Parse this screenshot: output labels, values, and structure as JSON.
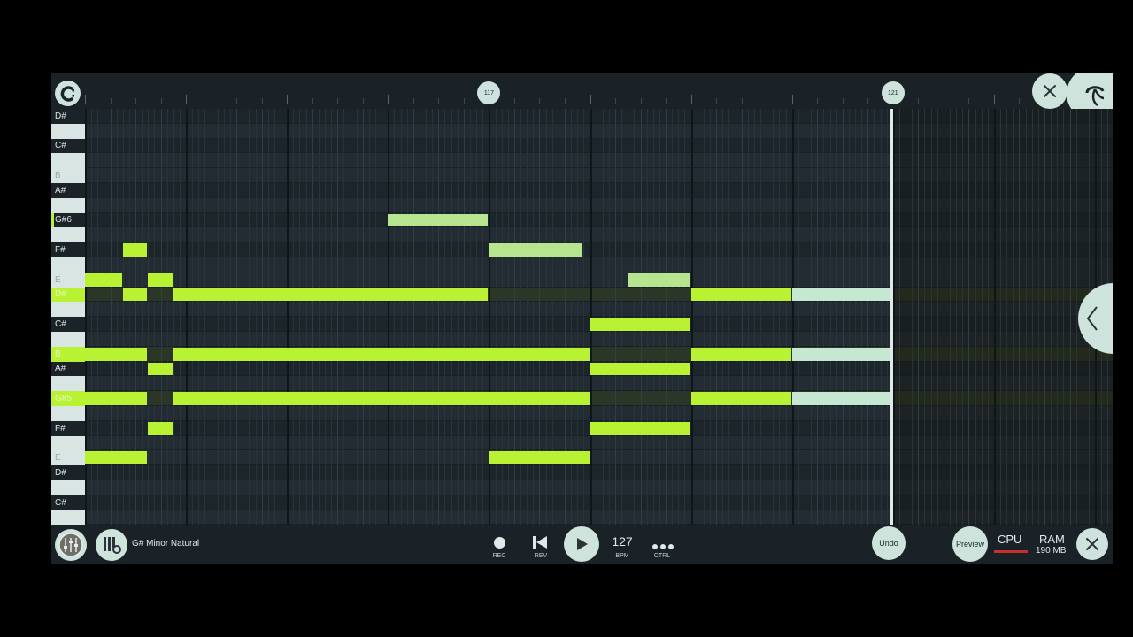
{
  "timeline": {
    "markers": [
      {
        "label": "117",
        "beat": 16
      },
      {
        "label": "121",
        "beat": 32
      }
    ]
  },
  "piano_keys": [
    {
      "label": "D#",
      "color": "black",
      "row": 0
    },
    {
      "label": "",
      "color": "white",
      "row": 1
    },
    {
      "label": "C#",
      "color": "black",
      "row": 2
    },
    {
      "label": "",
      "color": "white",
      "row": 3
    },
    {
      "label": "B",
      "color": "white",
      "row": 4
    },
    {
      "label": "A#",
      "color": "black",
      "row": 5
    },
    {
      "label": "",
      "color": "white",
      "row": 6
    },
    {
      "label": "G#6",
      "color": "root",
      "row": 7
    },
    {
      "label": "",
      "color": "white",
      "row": 8
    },
    {
      "label": "F#",
      "color": "black",
      "row": 9
    },
    {
      "label": "",
      "color": "white",
      "row": 10
    },
    {
      "label": "E",
      "color": "white",
      "row": 11
    },
    {
      "label": "D#",
      "color": "root",
      "row": 12
    },
    {
      "label": "",
      "color": "white",
      "row": 13
    },
    {
      "label": "C#",
      "color": "black",
      "row": 14
    },
    {
      "label": "",
      "color": "white",
      "row": 15
    },
    {
      "label": "B",
      "color": "root",
      "row": 16
    },
    {
      "label": "A#",
      "color": "black",
      "row": 17
    },
    {
      "label": "",
      "color": "white",
      "row": 18
    },
    {
      "label": "G#5",
      "color": "root",
      "row": 19
    },
    {
      "label": "",
      "color": "white",
      "row": 20
    },
    {
      "label": "F#",
      "color": "black",
      "row": 21
    },
    {
      "label": "",
      "color": "white",
      "row": 22
    },
    {
      "label": "E",
      "color": "white",
      "row": 23
    },
    {
      "label": "D#",
      "color": "black",
      "row": 24
    },
    {
      "label": "",
      "color": "white",
      "row": 25
    },
    {
      "label": "C#",
      "color": "black",
      "row": 26
    },
    {
      "label": "",
      "color": "white",
      "row": 27
    }
  ],
  "grid": {
    "beats_visible": 40.7,
    "playhead_beat": 31.9
  },
  "notes": [
    {
      "row": 7,
      "start": 12,
      "length": 4,
      "style": "light"
    },
    {
      "row": 9,
      "start": 1.5,
      "length": 1,
      "style": "green"
    },
    {
      "row": 9,
      "start": 16,
      "length": 3.75,
      "style": "light"
    },
    {
      "row": 11,
      "start": 0,
      "length": 1.5,
      "style": "green"
    },
    {
      "row": 11,
      "start": 2.5,
      "length": 1,
      "style": "green"
    },
    {
      "row": 11,
      "start": 21.5,
      "length": 2.5,
      "style": "light"
    },
    {
      "row": 12,
      "start": 1.5,
      "length": 1,
      "style": "green"
    },
    {
      "row": 12,
      "start": 3.5,
      "length": 12.5,
      "style": "green"
    },
    {
      "row": 12,
      "start": 24,
      "length": 4,
      "style": "green"
    },
    {
      "row": 12,
      "start": 28,
      "length": 4,
      "style": "pale"
    },
    {
      "row": 14,
      "start": 20,
      "length": 4,
      "style": "green"
    },
    {
      "row": 16,
      "start": 0,
      "length": 2.5,
      "style": "green"
    },
    {
      "row": 16,
      "start": 3.5,
      "length": 16.5,
      "style": "green"
    },
    {
      "row": 16,
      "start": 24,
      "length": 4,
      "style": "green"
    },
    {
      "row": 16,
      "start": 28,
      "length": 4,
      "style": "pale"
    },
    {
      "row": 17,
      "start": 2.5,
      "length": 1,
      "style": "green"
    },
    {
      "row": 17,
      "start": 20,
      "length": 4,
      "style": "green"
    },
    {
      "row": 19,
      "start": 0,
      "length": 2.5,
      "style": "green"
    },
    {
      "row": 19,
      "start": 3.5,
      "length": 16.5,
      "style": "green"
    },
    {
      "row": 19,
      "start": 24,
      "length": 4,
      "style": "green"
    },
    {
      "row": 19,
      "start": 28,
      "length": 4,
      "style": "pale"
    },
    {
      "row": 21,
      "start": 2.5,
      "length": 1,
      "style": "green"
    },
    {
      "row": 21,
      "start": 20,
      "length": 4,
      "style": "green"
    },
    {
      "row": 23,
      "start": 0,
      "length": 2.5,
      "style": "green"
    },
    {
      "row": 23,
      "start": 16,
      "length": 4,
      "style": "green"
    }
  ],
  "bottom": {
    "scale_label": "G# Minor Natural",
    "rec_label": "REC",
    "rev_label": "REV",
    "bpm_value": "127",
    "bpm_label": "BPM",
    "ctrl_label": "CTRL",
    "undo_label": "Undo",
    "preview_label": "Preview",
    "cpu_label": "CPU",
    "ram_label": "RAM",
    "ram_value": "190 MB"
  },
  "colors": {
    "note_green": "#b8f233",
    "note_light": "#b7e48e",
    "note_pale": "#c6e8d2",
    "accent": "#cfe3dd",
    "cpu_meter": "#c8302c"
  },
  "icons": [
    "logo-icon",
    "close-icon",
    "fruit-logo-icon",
    "chevron-left-icon",
    "mixer-icon",
    "piano-settings-icon",
    "record-icon",
    "rewind-icon",
    "play-icon",
    "more-icon"
  ]
}
